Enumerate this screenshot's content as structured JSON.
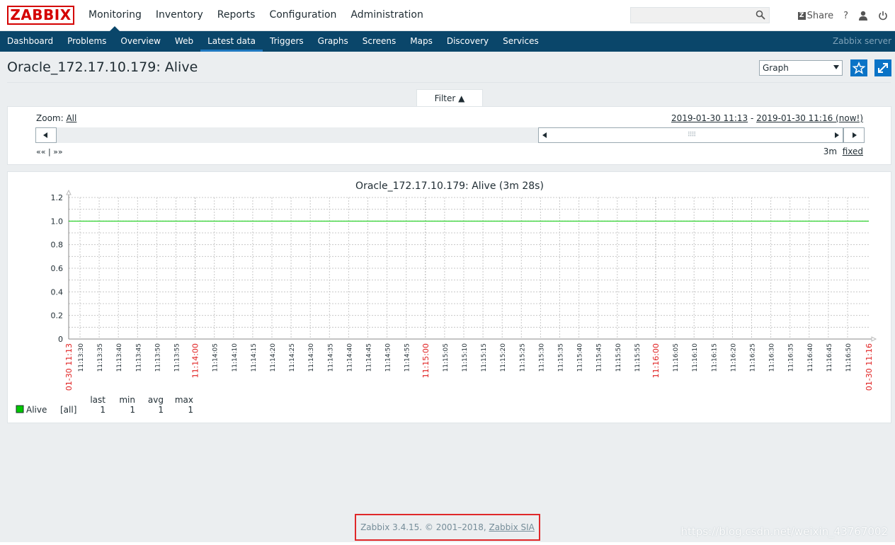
{
  "brand": {
    "logo_text": "ZABBIX",
    "color": "#d40000"
  },
  "top_menu": [
    "Monitoring",
    "Inventory",
    "Reports",
    "Configuration",
    "Administration"
  ],
  "top_menu_active": "Monitoring",
  "header_actions": {
    "share": "Share",
    "help": "?"
  },
  "sub_menu": [
    "Dashboard",
    "Problems",
    "Overview",
    "Web",
    "Latest data",
    "Triggers",
    "Graphs",
    "Screens",
    "Maps",
    "Discovery",
    "Services"
  ],
  "sub_menu_active": "Latest data",
  "server_name": "Zabbix server",
  "page": {
    "title": "Oracle_172.17.10.179: Alive",
    "view_select": "Graph"
  },
  "filter": {
    "tab_label": "Filter ▲",
    "zoom_label": "Zoom:",
    "zoom_all": "All",
    "period_from": "2019-01-30 11:13",
    "period_sep": " - ",
    "period_to": "2019-01-30 11:16 (now!)",
    "nav_left": "«« |",
    "nav_right": "»»",
    "length": "3m",
    "fixed": "fixed"
  },
  "chart_data": {
    "type": "line",
    "title": "Oracle_172.17.10.179: Alive (3m 28s)",
    "yticks": [
      "1.2",
      "1.0",
      "0.8",
      "0.6",
      "0.4",
      "0.2",
      "0"
    ],
    "ylim": [
      0,
      1.2
    ],
    "x_ticks": [
      "01-30 11:13",
      "11:13:30",
      "11:13:35",
      "11:13:40",
      "11:13:45",
      "11:13:50",
      "11:13:55",
      "11:14:00",
      "11:14:05",
      "11:14:10",
      "11:14:15",
      "11:14:20",
      "11:14:25",
      "11:14:30",
      "11:14:35",
      "11:14:40",
      "11:14:45",
      "11:14:50",
      "11:14:55",
      "11:15:00",
      "11:15:05",
      "11:15:10",
      "11:15:15",
      "11:15:20",
      "11:15:25",
      "11:15:30",
      "11:15:35",
      "11:15:40",
      "11:15:45",
      "11:15:50",
      "11:15:55",
      "11:16:00",
      "11:16:05",
      "11:16:10",
      "11:16:15",
      "11:16:20",
      "11:16:25",
      "11:16:30",
      "11:16:35",
      "11:16:40",
      "11:16:45",
      "11:16:50",
      "01-30 11:16"
    ],
    "x_ticks_highlight": [
      "01-30 11:13",
      "11:14:00",
      "11:15:00",
      "11:16:00",
      "01-30 11:16"
    ],
    "series": [
      {
        "name": "Alive",
        "color": "#00c800",
        "values": [
          1,
          1
        ],
        "x": [
          "2019-01-30 11:13",
          "2019-01-30 11:16"
        ]
      }
    ],
    "grid": true,
    "legend": {
      "headers": [
        "last",
        "min",
        "avg",
        "max"
      ],
      "rows": [
        {
          "name": "Alive",
          "func": "[all]",
          "last": "1",
          "min": "1",
          "avg": "1",
          "max": "1"
        }
      ]
    }
  },
  "footer": {
    "text": "Zabbix 3.4.15. © 2001–2018,",
    "link": "Zabbix SIA",
    "watermark": "https://blog.csdn.net/weixin_43767002"
  }
}
